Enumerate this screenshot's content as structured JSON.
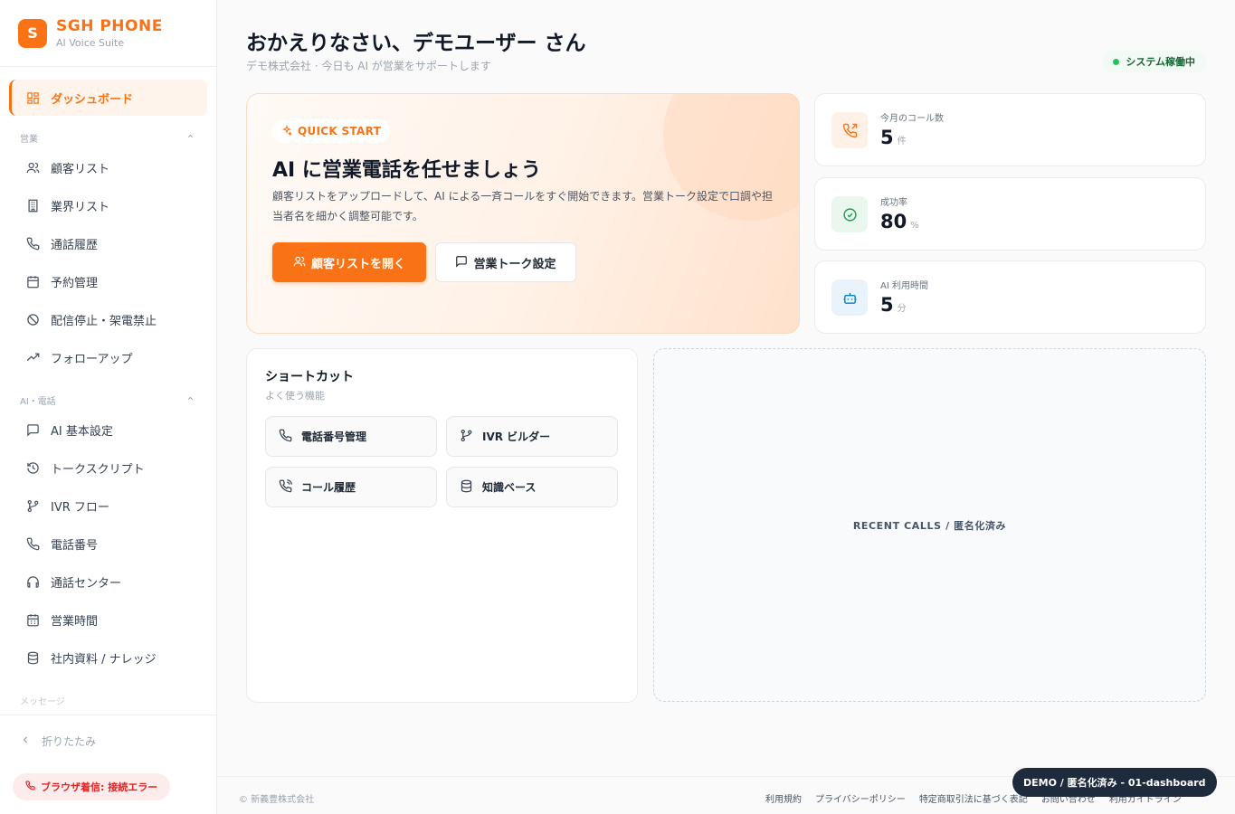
{
  "brand": {
    "logo_letter": "S",
    "name": "SGH PHONE",
    "subtitle": "AI Voice Suite",
    "accent": "#f97316"
  },
  "sidebar": {
    "active": {
      "label": "ダッシュボード",
      "icon": "dashboard-icon"
    },
    "sections": [
      {
        "title": "営業",
        "items": [
          {
            "label": "顧客リスト",
            "icon": "users-icon"
          },
          {
            "label": "業界リスト",
            "icon": "building-icon"
          },
          {
            "label": "通話履歴",
            "icon": "phone-icon"
          },
          {
            "label": "予約管理",
            "icon": "calendar-icon"
          },
          {
            "label": "配信停止・架電禁止",
            "icon": "ban-icon"
          },
          {
            "label": "フォローアップ",
            "icon": "trend-icon"
          }
        ]
      },
      {
        "title": "AI・電話",
        "items": [
          {
            "label": "AI 基本設定",
            "icon": "chat-icon"
          },
          {
            "label": "トークスクリプト",
            "icon": "history-icon"
          },
          {
            "label": "IVR フロー",
            "icon": "branch-icon"
          },
          {
            "label": "電話番号",
            "icon": "phone-icon"
          },
          {
            "label": "通話センター",
            "icon": "headset-icon"
          },
          {
            "label": "営業時間",
            "icon": "calendar-icon"
          },
          {
            "label": "社内資料 / ナレッジ",
            "icon": "database-icon"
          }
        ]
      },
      {
        "title": "メッセージ"
      }
    ],
    "collapse_label": "折りたたみ",
    "error_badge": "ブラウザ着信: 接続エラー"
  },
  "header": {
    "greeting": "おかえりなさい、デモユーザー さん",
    "subtitle": "デモ株式会社 · 今日も AI が営業をサポートします",
    "status": "システム稼働中",
    "status_color": "#22c55e"
  },
  "hero": {
    "tag": "QUICK START",
    "title": "AI に営業電話を任せましょう",
    "description": "顧客リストをアップロードして、AI による一斉コールをすぐ開始できます。営業トーク設定で口調や担当者名を細かく調整可能です。",
    "primary_button": "顧客リストを開く",
    "secondary_button": "営業トーク設定"
  },
  "stats": [
    {
      "label": "今月のコール数",
      "value": "5",
      "unit": "件",
      "icon": "phone-outgoing-icon",
      "color": "#f97316"
    },
    {
      "label": "成功率",
      "value": "80",
      "unit": "%",
      "icon": "check-circle-icon",
      "color": "#16a34a"
    },
    {
      "label": "AI 利用時間",
      "value": "5",
      "unit": "分",
      "icon": "bot-icon",
      "color": "#0284c7"
    }
  ],
  "shortcuts": {
    "title": "ショートカット",
    "subtitle": "よく使う機能",
    "items": [
      {
        "label": "電話番号管理",
        "icon": "phone-icon"
      },
      {
        "label": "IVR ビルダー",
        "icon": "branch-icon"
      },
      {
        "label": "コール履歴",
        "icon": "phone-call-icon"
      },
      {
        "label": "知識ベース",
        "icon": "database-icon"
      }
    ]
  },
  "recent_calls": {
    "label": "RECENT CALLS / 匿名化済み"
  },
  "footer": {
    "copyright": "© 新義豊株式会社",
    "links": [
      "利用規約",
      "プライバシーポリシー",
      "特定商取引法に基づく表記",
      "お問い合わせ",
      "利用ガイドライン"
    ]
  },
  "demo_badge": "DEMO / 匿名化済み - 01-dashboard"
}
